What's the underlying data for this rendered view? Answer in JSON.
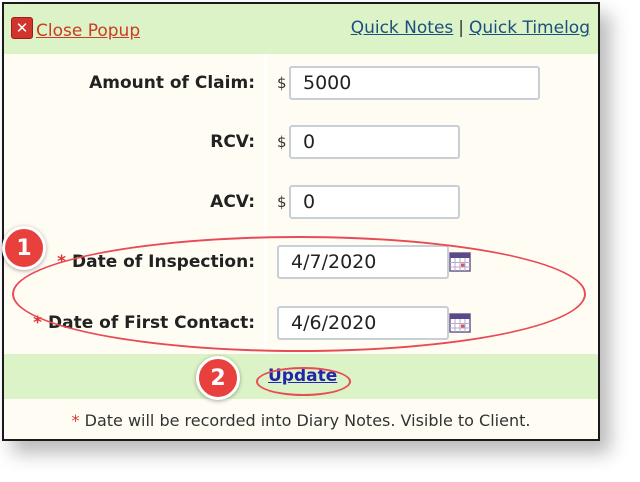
{
  "header": {
    "close_label": "Close Popup",
    "quick_notes": "Quick Notes",
    "separator": "|",
    "quick_timelog": "Quick Timelog"
  },
  "form": {
    "currency": "$",
    "required_mark": "*",
    "amount_label": "Amount of Claim:",
    "amount_value": "5000",
    "rcv_label": "RCV:",
    "rcv_value": "0",
    "acv_label": "ACV:",
    "acv_value": "0",
    "inspection_label": "Date of Inspection:",
    "inspection_value": "4/7/2020",
    "first_contact_label": "Date of First Contact:",
    "first_contact_value": "4/6/2020"
  },
  "update_label": "Update",
  "footnote": {
    "mark": "*",
    "text": " Date will be recorded into Diary Notes. Visible to Client."
  },
  "annotations": {
    "step1": "1",
    "step2": "2"
  },
  "colors": {
    "header_bg": "#dbf3c7",
    "form_bg": "#fffdf3",
    "annotation_red": "#e8413d",
    "link_blue": "#1d4e7e",
    "close_red": "#cc3b22"
  }
}
